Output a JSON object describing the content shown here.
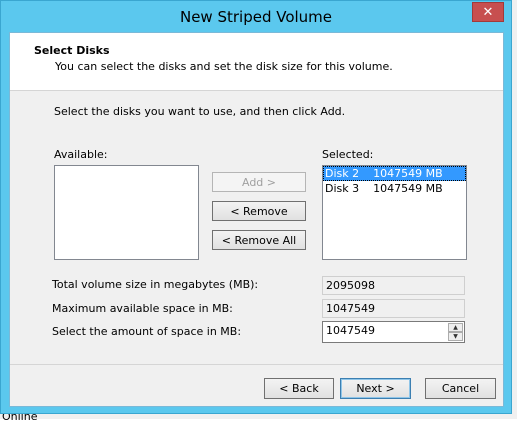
{
  "window": {
    "title": "New Striped Volume",
    "close_glyph": "✕"
  },
  "header": {
    "title": "Select Disks",
    "subtitle": "You can select the disks and set the disk size for this volume."
  },
  "instruction": "Select the disks you want to use, and then click Add.",
  "available": {
    "label": "Available:",
    "items": []
  },
  "selected": {
    "label": "Selected:",
    "items": [
      {
        "disk": "Disk 2",
        "size": "1047549 MB",
        "selected": true
      },
      {
        "disk": "Disk 3",
        "size": "1047549 MB",
        "selected": false
      }
    ]
  },
  "buttons": {
    "add": "Add >",
    "remove": "< Remove",
    "remove_all": "< Remove All",
    "back": "< Back",
    "next": "Next >",
    "cancel": "Cancel"
  },
  "fields": {
    "total_label": "Total volume size in megabytes (MB):",
    "total_value": "2095098",
    "max_label": "Maximum available space in MB:",
    "max_value": "1047549",
    "amount_label": "Select the amount of space in MB:",
    "amount_value": "1047549"
  },
  "background": {
    "partial_text": "Online"
  },
  "colors": {
    "titlebar": "#5bc8ee",
    "selection": "#3399ff",
    "close": "#c74f4f"
  }
}
